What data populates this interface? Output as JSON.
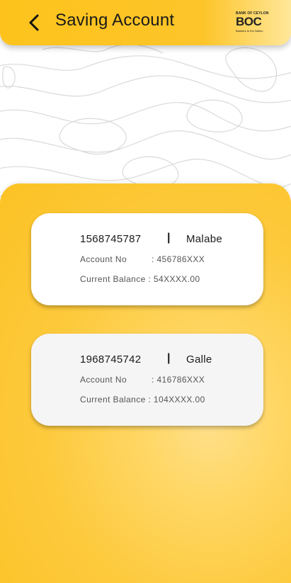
{
  "header": {
    "title": "Saving Account",
    "back_icon": "chevron-left-icon",
    "logo": {
      "top_text": "BANK OF CEYLON",
      "main_text": "BOC",
      "tagline": "Bankers to the Nation"
    }
  },
  "colors": {
    "accent": "#fdc31c",
    "card_primary": "#ffffff",
    "card_secondary": "#f5f5f5",
    "text": "#1a1a1a"
  },
  "accounts": [
    {
      "number": "1568745787",
      "separator": "|",
      "branch": "Malabe",
      "account_no_label": "Account No",
      "account_no_value": ": 456786XXX",
      "balance_label": "Current Balance",
      "balance_value": " : 54XXXX.00"
    },
    {
      "number": "1968745742",
      "separator": "|",
      "branch": "Galle",
      "account_no_label": "Account No",
      "account_no_value": ": 416786XXX",
      "balance_label": "Current Balance",
      "balance_value": " : 104XXXX.00"
    }
  ]
}
